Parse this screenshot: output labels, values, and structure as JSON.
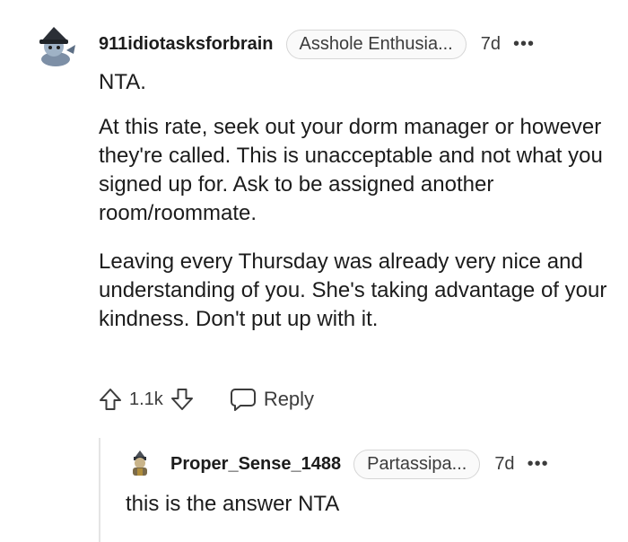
{
  "comment": {
    "username": "911idiotasksforbrain",
    "flair": "Asshole Enthusia...",
    "age": "7d",
    "more": "•••",
    "paragraphs": [
      "NTA.",
      "At this rate, seek out your dorm manager or however they're called. This is unacceptable and not what you signed up for. Ask to be assigned another room/roommate.",
      "Leaving every Thursday was already very nice and understanding of you. She's taking advantage of your kindness. Don't put up with it."
    ],
    "score": "1.1k",
    "reply_label": "Reply"
  },
  "reply": {
    "username": "Proper_Sense_1488",
    "flair": "Partassipa...",
    "age": "7d",
    "more": "•••",
    "text": "this is the answer NTA"
  },
  "icons": {
    "upvote": "arrow-up-icon",
    "downvote": "arrow-down-icon",
    "reply": "speech-bubble-icon",
    "more": "ellipsis-icon"
  },
  "colors": {
    "text": "#1c1c1c",
    "secondary": "#3c3c3c",
    "flair_border": "#d6d6d6",
    "thread_line": "#e4e4e4"
  }
}
